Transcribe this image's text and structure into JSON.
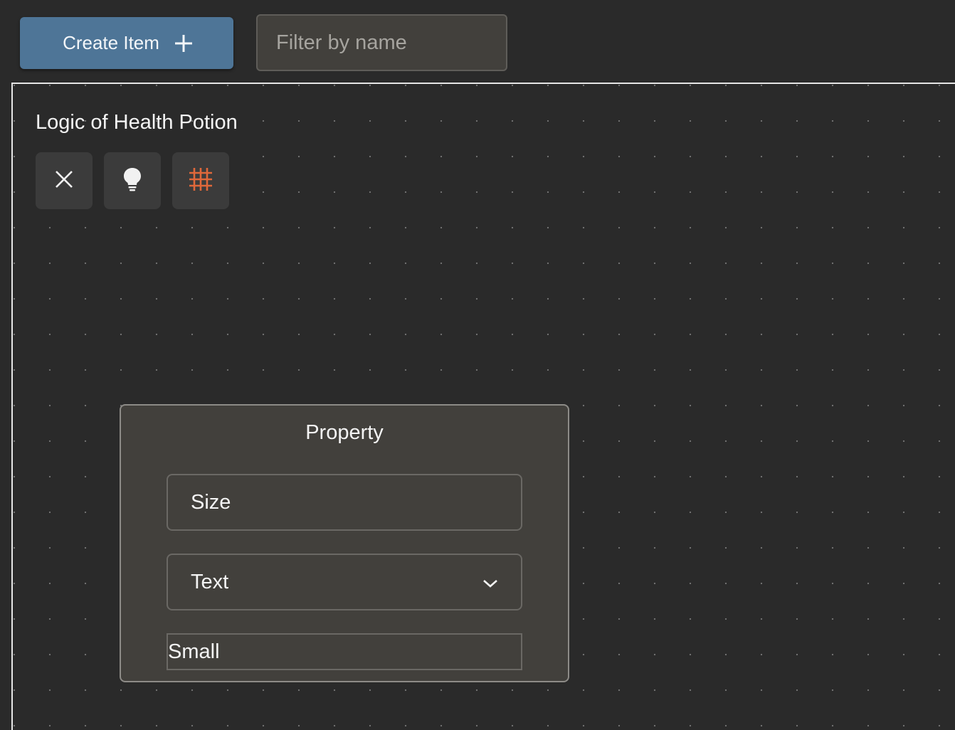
{
  "toolbar": {
    "create_label": "Create Item",
    "filter_placeholder": "Filter by name",
    "filter_value": ""
  },
  "canvas": {
    "title": "Logic of Health Potion",
    "tools": [
      {
        "icon": "close-icon"
      },
      {
        "icon": "lightbulb-icon"
      },
      {
        "icon": "grid-icon",
        "color": "#e0683a"
      }
    ]
  },
  "node": {
    "title": "Property",
    "name_value": "Size",
    "type_selected": "Text",
    "value": "Small"
  },
  "colors": {
    "background": "#2a2a2a",
    "primary_button": "#4e7597",
    "panel": "#42403c",
    "accent": "#e0683a"
  }
}
